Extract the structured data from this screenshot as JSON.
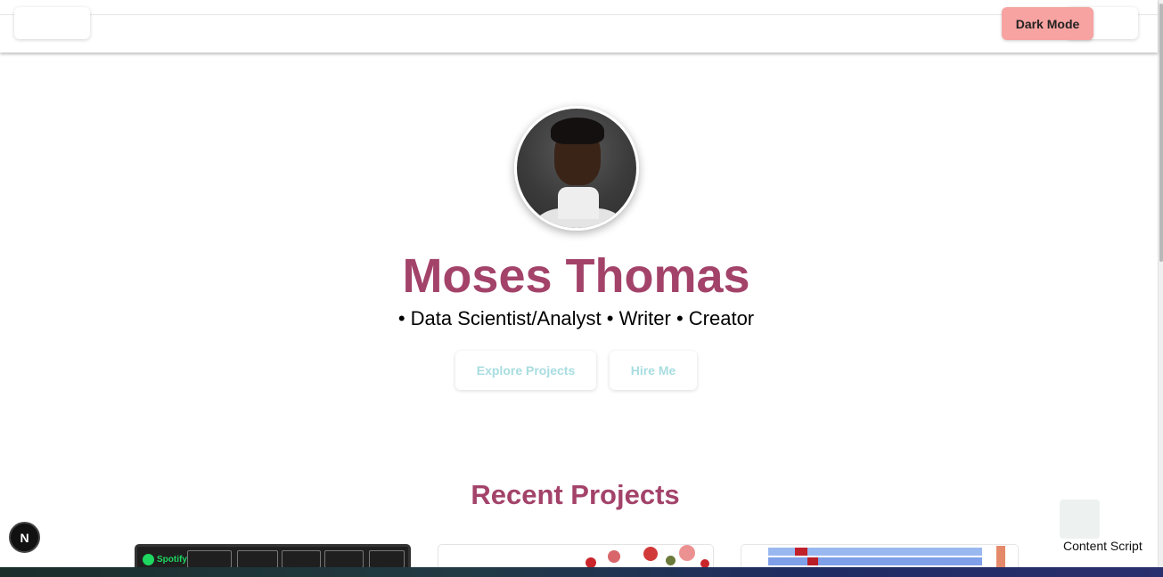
{
  "header": {
    "dark_mode_label": "Dark Mode"
  },
  "hero": {
    "name": "Moses Thomas",
    "tagline": "• Data Scientist/Analyst • Writer • Creator",
    "explore_label": "Explore Projects",
    "hire_label": "Hire Me"
  },
  "projects": {
    "title": "Recent Projects",
    "spotify_text": "Spotify"
  },
  "badges": {
    "n_label": "N",
    "content_script_label": "Content Script"
  },
  "colors": {
    "accent": "#a3436a",
    "dark_mode_bg": "#f7a3a1",
    "cta_text": "#a8dde0"
  }
}
